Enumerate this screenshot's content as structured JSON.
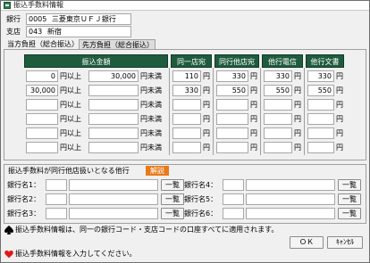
{
  "window": {
    "title": "振込手数料情報"
  },
  "bank": {
    "label": "銀行",
    "code": "0005",
    "name": "三菱東京ＵＦＪ銀行"
  },
  "branch": {
    "label": "支店",
    "code": "043",
    "name": "新宿"
  },
  "tabs": [
    {
      "label": "当方負担（総合振込）",
      "active": true
    },
    {
      "label": "先方負担（総合振込）",
      "active": false
    }
  ],
  "table": {
    "headers": [
      "振込金額",
      "同一店宛",
      "同行他店宛",
      "他行電信",
      "他行文書"
    ],
    "from_unit": "円以上",
    "to_unit": "円未満",
    "fee_unit": "円",
    "rows": [
      {
        "from": "0",
        "to": "30,000",
        "fees": [
          "110",
          "330",
          "330",
          "330"
        ]
      },
      {
        "from": "30,000",
        "to": "",
        "fees": [
          "330",
          "550",
          "550",
          "550"
        ]
      },
      {
        "from": "",
        "to": "",
        "fees": [
          "",
          "",
          "",
          ""
        ]
      },
      {
        "from": "",
        "to": "",
        "fees": [
          "",
          "",
          "",
          ""
        ]
      },
      {
        "from": "",
        "to": "",
        "fees": [
          "",
          "",
          "",
          ""
        ]
      },
      {
        "from": "",
        "to": "",
        "fees": [
          "",
          "",
          "",
          ""
        ]
      }
    ]
  },
  "other_banks": {
    "title": "振込手数料が同行他店扱いとなる他行",
    "explain_button": "解説",
    "lookup_label": "一覧",
    "left": [
      {
        "label": "銀行名1：",
        "value": ""
      },
      {
        "label": "銀行名2：",
        "value": ""
      },
      {
        "label": "銀行名3：",
        "value": ""
      }
    ],
    "right": [
      {
        "label": "銀行名4：",
        "value": ""
      },
      {
        "label": "銀行名5：",
        "value": ""
      },
      {
        "label": "銀行名6：",
        "value": ""
      }
    ]
  },
  "note": "振込手数料情報は、同一の銀行コード・支店コードの口座すべてに適用されます。",
  "ok_label": "ＯＫ",
  "cancel_label": "ｷｬﾝｾﾙ",
  "status": "振込手数料情報を入力してください。",
  "colors": {
    "header_bg": "#1f5c3e",
    "accent_orange": "#e87a18",
    "heart": "#e01818"
  }
}
